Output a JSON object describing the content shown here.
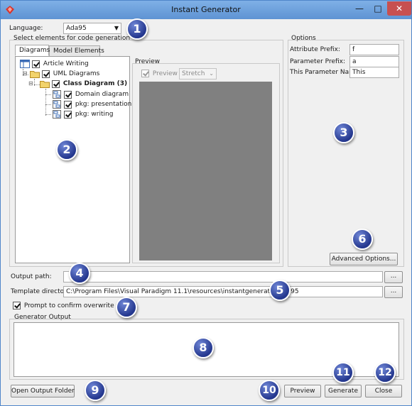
{
  "window": {
    "title": "Instant Generator"
  },
  "language": {
    "label": "Language:",
    "value": "Ada95"
  },
  "select_group": {
    "title": "Select elements for code generation"
  },
  "tabs": [
    {
      "label": "Diagrams"
    },
    {
      "label": "Model Elements"
    }
  ],
  "tree": [
    {
      "label": "Article Writing"
    },
    {
      "label": "UML Diagrams"
    },
    {
      "label": "Class Diagram (3)"
    },
    {
      "label": "Domain diagram"
    },
    {
      "label": "pkg: presentation"
    },
    {
      "label": "pkg: writing"
    }
  ],
  "preview_panel": {
    "title": "Preview",
    "checkbox_label": "Preview",
    "stretch_value": "Stretch"
  },
  "options": {
    "title": "Options",
    "attribute_prefix": {
      "label": "Attribute Prefix:",
      "value": "f"
    },
    "parameter_prefix": {
      "label": "Parameter Prefix:",
      "value": "a"
    },
    "this_parameter_name": {
      "label": "This Parameter Name:",
      "value": "This"
    },
    "advanced_button": "Advanced Options..."
  },
  "output_path": {
    "label": "Output path:",
    "value": "",
    "browse": "..."
  },
  "template_directory": {
    "label": "Template directory:",
    "value": "C:\\Program Files\\Visual Paradigm 11.1\\resources\\instantgenerator\\ada95",
    "browse": "..."
  },
  "prompt_overwrite": {
    "label": "Prompt to confirm overwrite file"
  },
  "generator_output": {
    "title": "Generator Output"
  },
  "buttons": {
    "open_output_folder": "Open Output Folder",
    "preview": "Preview",
    "generate": "Generate",
    "close": "Close"
  },
  "callouts": [
    "1",
    "2",
    "3",
    "4",
    "5",
    "6",
    "7",
    "8",
    "9",
    "10",
    "11",
    "12"
  ],
  "colors": {
    "titlebar": "#6fa0d8",
    "preview_canvas": "#808080",
    "callout": "#2b3f97"
  }
}
